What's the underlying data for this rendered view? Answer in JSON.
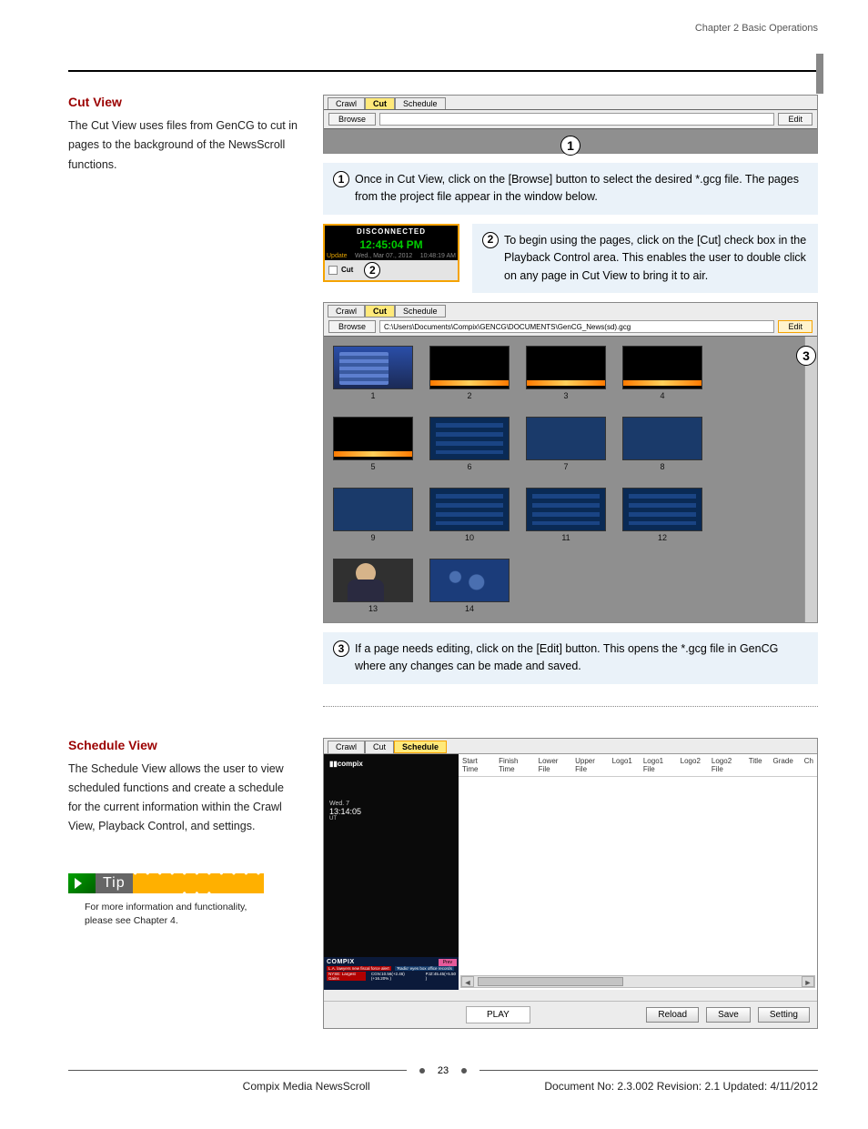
{
  "header": {
    "chapter": "Chapter 2 Basic Operations"
  },
  "cutview": {
    "heading": "Cut View",
    "intro": "The Cut View uses files from GenCG to cut in pages to the background of the NewsScroll functions.",
    "tabs": {
      "crawl": "Crawl",
      "cut": "Cut",
      "schedule": "Schedule"
    },
    "browse_btn": "Browse",
    "edit_btn": "Edit",
    "step1": "Once in Cut View, click on the [Browse] button to select the desired *.gcg file. The pages from the project file appear in the window below.",
    "step2": "To begin using the pages, click on the [Cut] check box in the Playback Control area. This enables the user to double click on any page in Cut View to bring it to air.",
    "step3": "If a page needs editing, click on the [Edit] button. This opens the *.gcg file in GenCG where any changes can be made and saved.",
    "playback": {
      "disconnected": "DISCONNECTED",
      "time": "12:45:04   PM",
      "update_l": "Update",
      "update_c": "Wed., Mar 07., 2012",
      "update_r": "10:48:19 AM",
      "cut_chk": "Cut"
    },
    "file_path": "C:\\Users\\Documents\\Compix\\GENCG\\DOCUMENTS\\GenCG_News(sd).gcg",
    "thumb_labels": [
      "1",
      "2",
      "3",
      "4",
      "5",
      "6",
      "7",
      "8",
      "9",
      "10",
      "11",
      "12",
      "13",
      "14"
    ]
  },
  "schedule": {
    "heading": "Schedule View",
    "intro": "The Schedule View allows the user to view scheduled functions and create a schedule for the current information within the Crawl View, Playback Control, and settings.",
    "columns": [
      "Start Time",
      "Finish Time",
      "Lower File",
      "Upper File",
      "Logo1",
      "Logo1 File",
      "Logo2",
      "Logo2 File",
      "Title",
      "Grade",
      "Ch"
    ],
    "preview": {
      "logo": "compix",
      "day": "Wed. 7",
      "time": "13:14:05",
      "ut": "UT",
      "brand": "COMPIX",
      "prev_btn": "Prev",
      "ticker_a": "L.A. lawyers new fiscal force alert",
      "ticker_b": "‘Radio’ eyes box office records",
      "ticker_c": "NYSE: Largest Gains",
      "ticker_d": "CGN:10.56(+2.46)(+16.20% )",
      "ticker_e": "PJZ:45.45(+5.50 )"
    },
    "buttons": {
      "play": "PLAY",
      "reload": "Reload",
      "save": "Save",
      "setting": "Setting"
    }
  },
  "tip": {
    "label": "Tip",
    "text": "For more information and functionality, please see Chapter 4."
  },
  "footer": {
    "page_num": "23",
    "product": "Compix Media NewsScroll",
    "docline": "Document No: 2.3.002 Revision: 2.1 Updated: 4/11/2012"
  }
}
